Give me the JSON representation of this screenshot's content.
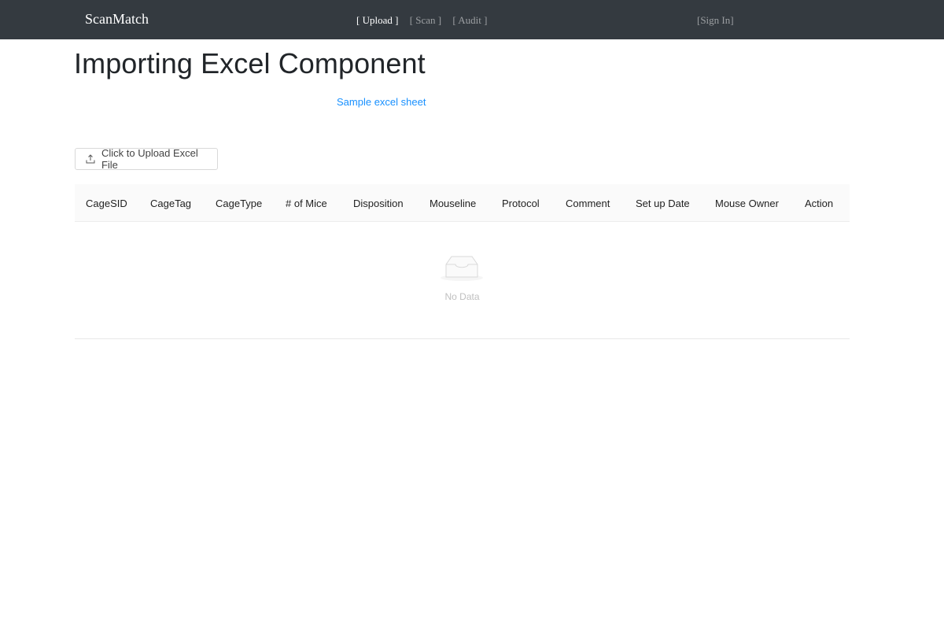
{
  "navbar": {
    "brand": "ScanMatch",
    "links": [
      {
        "label": "[ Upload ]",
        "active": true
      },
      {
        "label": "[ Scan ]",
        "active": false
      },
      {
        "label": "[ Audit ]",
        "active": false
      }
    ],
    "sign_in": "[Sign In]"
  },
  "page": {
    "title": "Importing Excel Component",
    "sample_link": "Sample excel sheet",
    "upload_button": "Click to Upload Excel File",
    "upload_icon": "upload-icon"
  },
  "table": {
    "columns": [
      "CageSID",
      "CageTag",
      "CageType",
      "# of Mice",
      "Disposition",
      "Mouseline",
      "Protocol",
      "Comment",
      "Set up Date",
      "Mouse Owner",
      "Action"
    ],
    "rows": [],
    "empty_text": "No Data",
    "empty_icon": "inbox-icon"
  }
}
